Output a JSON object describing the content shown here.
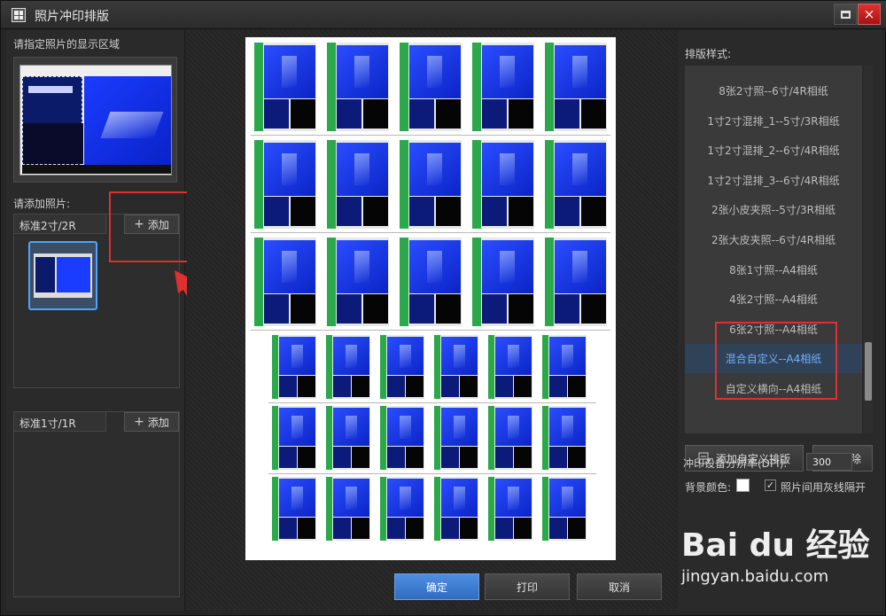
{
  "window": {
    "title": "照片冲印排版",
    "maximize_label": "",
    "close_label": "×"
  },
  "left": {
    "area_label": "请指定照片的显示区域",
    "add_photo_label": "请添加照片:",
    "group1": {
      "tab": "标准2寸/2R",
      "add": "添加"
    },
    "group2": {
      "tab": "标准1寸/1R",
      "add": "添加"
    }
  },
  "style_panel": {
    "label": "排版样式:",
    "items": [
      "8张2寸照--6寸/4R相纸",
      "1寸2寸混排_1--5寸/3R相纸",
      "1寸2寸混排_2--6寸/4R相纸",
      "1寸2寸混排_3--6寸/4R相纸",
      "2张小皮夹照--5寸/3R相纸",
      "2张大皮夹照--6寸/4R相纸",
      "8张1寸照--A4相纸",
      "4张2寸照--A4相纸",
      "6张2寸照--A4相纸",
      "混合自定义--A4相纸",
      "自定义横向--A4相纸"
    ],
    "selected_index": 9,
    "add_custom": "添加自定义排版",
    "delete": "删除",
    "dpi_label": "冲印设备分辨率(DPI):",
    "dpi_value": "300",
    "bg_color_label": "背景颜色:",
    "bg_color": "#ffffff",
    "separator_label": "照片间用灰线隔开",
    "separator_checked": true
  },
  "buttons": {
    "ok": "确定",
    "print": "打印",
    "cancel": "取消"
  },
  "watermark": {
    "logo": "Bai du 经验",
    "url": "jingyan.baidu.com"
  },
  "colors": {
    "accent": "#4f8fe0",
    "selected_text": "#6fb0ff",
    "highlight_red": "#e03030"
  }
}
